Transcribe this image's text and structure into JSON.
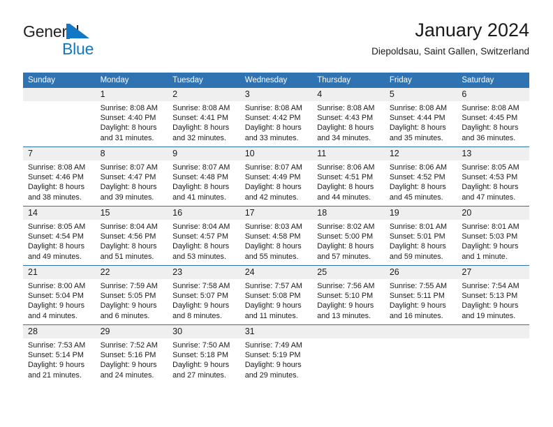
{
  "brand": {
    "word1": "General",
    "word2": "Blue",
    "mark_icon": "triangle-logo-icon",
    "primary_color": "#1277c4",
    "text_color": "#231f20"
  },
  "header": {
    "title": "January 2024",
    "subtitle": "Diepoldsau, Saint Gallen, Switzerland"
  },
  "theme": {
    "header_blue": "#3073b3",
    "row_divider_blue": "#2f6fae",
    "daynum_band": "#efefef",
    "page_background": "#ffffff"
  },
  "calendar": {
    "weekday_headers": [
      "Sunday",
      "Monday",
      "Tuesday",
      "Wednesday",
      "Thursday",
      "Friday",
      "Saturday"
    ],
    "weeks": [
      [
        {
          "day": "",
          "sunrise": "",
          "sunset": "",
          "daylight": ""
        },
        {
          "day": "1",
          "sunrise": "Sunrise: 8:08 AM",
          "sunset": "Sunset: 4:40 PM",
          "daylight": "Daylight: 8 hours and 31 minutes."
        },
        {
          "day": "2",
          "sunrise": "Sunrise: 8:08 AM",
          "sunset": "Sunset: 4:41 PM",
          "daylight": "Daylight: 8 hours and 32 minutes."
        },
        {
          "day": "3",
          "sunrise": "Sunrise: 8:08 AM",
          "sunset": "Sunset: 4:42 PM",
          "daylight": "Daylight: 8 hours and 33 minutes."
        },
        {
          "day": "4",
          "sunrise": "Sunrise: 8:08 AM",
          "sunset": "Sunset: 4:43 PM",
          "daylight": "Daylight: 8 hours and 34 minutes."
        },
        {
          "day": "5",
          "sunrise": "Sunrise: 8:08 AM",
          "sunset": "Sunset: 4:44 PM",
          "daylight": "Daylight: 8 hours and 35 minutes."
        },
        {
          "day": "6",
          "sunrise": "Sunrise: 8:08 AM",
          "sunset": "Sunset: 4:45 PM",
          "daylight": "Daylight: 8 hours and 36 minutes."
        }
      ],
      [
        {
          "day": "7",
          "sunrise": "Sunrise: 8:08 AM",
          "sunset": "Sunset: 4:46 PM",
          "daylight": "Daylight: 8 hours and 38 minutes."
        },
        {
          "day": "8",
          "sunrise": "Sunrise: 8:07 AM",
          "sunset": "Sunset: 4:47 PM",
          "daylight": "Daylight: 8 hours and 39 minutes."
        },
        {
          "day": "9",
          "sunrise": "Sunrise: 8:07 AM",
          "sunset": "Sunset: 4:48 PM",
          "daylight": "Daylight: 8 hours and 41 minutes."
        },
        {
          "day": "10",
          "sunrise": "Sunrise: 8:07 AM",
          "sunset": "Sunset: 4:49 PM",
          "daylight": "Daylight: 8 hours and 42 minutes."
        },
        {
          "day": "11",
          "sunrise": "Sunrise: 8:06 AM",
          "sunset": "Sunset: 4:51 PM",
          "daylight": "Daylight: 8 hours and 44 minutes."
        },
        {
          "day": "12",
          "sunrise": "Sunrise: 8:06 AM",
          "sunset": "Sunset: 4:52 PM",
          "daylight": "Daylight: 8 hours and 45 minutes."
        },
        {
          "day": "13",
          "sunrise": "Sunrise: 8:05 AM",
          "sunset": "Sunset: 4:53 PM",
          "daylight": "Daylight: 8 hours and 47 minutes."
        }
      ],
      [
        {
          "day": "14",
          "sunrise": "Sunrise: 8:05 AM",
          "sunset": "Sunset: 4:54 PM",
          "daylight": "Daylight: 8 hours and 49 minutes."
        },
        {
          "day": "15",
          "sunrise": "Sunrise: 8:04 AM",
          "sunset": "Sunset: 4:56 PM",
          "daylight": "Daylight: 8 hours and 51 minutes."
        },
        {
          "day": "16",
          "sunrise": "Sunrise: 8:04 AM",
          "sunset": "Sunset: 4:57 PM",
          "daylight": "Daylight: 8 hours and 53 minutes."
        },
        {
          "day": "17",
          "sunrise": "Sunrise: 8:03 AM",
          "sunset": "Sunset: 4:58 PM",
          "daylight": "Daylight: 8 hours and 55 minutes."
        },
        {
          "day": "18",
          "sunrise": "Sunrise: 8:02 AM",
          "sunset": "Sunset: 5:00 PM",
          "daylight": "Daylight: 8 hours and 57 minutes."
        },
        {
          "day": "19",
          "sunrise": "Sunrise: 8:01 AM",
          "sunset": "Sunset: 5:01 PM",
          "daylight": "Daylight: 8 hours and 59 minutes."
        },
        {
          "day": "20",
          "sunrise": "Sunrise: 8:01 AM",
          "sunset": "Sunset: 5:03 PM",
          "daylight": "Daylight: 9 hours and 1 minute."
        }
      ],
      [
        {
          "day": "21",
          "sunrise": "Sunrise: 8:00 AM",
          "sunset": "Sunset: 5:04 PM",
          "daylight": "Daylight: 9 hours and 4 minutes."
        },
        {
          "day": "22",
          "sunrise": "Sunrise: 7:59 AM",
          "sunset": "Sunset: 5:05 PM",
          "daylight": "Daylight: 9 hours and 6 minutes."
        },
        {
          "day": "23",
          "sunrise": "Sunrise: 7:58 AM",
          "sunset": "Sunset: 5:07 PM",
          "daylight": "Daylight: 9 hours and 8 minutes."
        },
        {
          "day": "24",
          "sunrise": "Sunrise: 7:57 AM",
          "sunset": "Sunset: 5:08 PM",
          "daylight": "Daylight: 9 hours and 11 minutes."
        },
        {
          "day": "25",
          "sunrise": "Sunrise: 7:56 AM",
          "sunset": "Sunset: 5:10 PM",
          "daylight": "Daylight: 9 hours and 13 minutes."
        },
        {
          "day": "26",
          "sunrise": "Sunrise: 7:55 AM",
          "sunset": "Sunset: 5:11 PM",
          "daylight": "Daylight: 9 hours and 16 minutes."
        },
        {
          "day": "27",
          "sunrise": "Sunrise: 7:54 AM",
          "sunset": "Sunset: 5:13 PM",
          "daylight": "Daylight: 9 hours and 19 minutes."
        }
      ],
      [
        {
          "day": "28",
          "sunrise": "Sunrise: 7:53 AM",
          "sunset": "Sunset: 5:14 PM",
          "daylight": "Daylight: 9 hours and 21 minutes."
        },
        {
          "day": "29",
          "sunrise": "Sunrise: 7:52 AM",
          "sunset": "Sunset: 5:16 PM",
          "daylight": "Daylight: 9 hours and 24 minutes."
        },
        {
          "day": "30",
          "sunrise": "Sunrise: 7:50 AM",
          "sunset": "Sunset: 5:18 PM",
          "daylight": "Daylight: 9 hours and 27 minutes."
        },
        {
          "day": "31",
          "sunrise": "Sunrise: 7:49 AM",
          "sunset": "Sunset: 5:19 PM",
          "daylight": "Daylight: 9 hours and 29 minutes."
        },
        {
          "day": "",
          "sunrise": "",
          "sunset": "",
          "daylight": ""
        },
        {
          "day": "",
          "sunrise": "",
          "sunset": "",
          "daylight": ""
        },
        {
          "day": "",
          "sunrise": "",
          "sunset": "",
          "daylight": ""
        }
      ]
    ]
  }
}
